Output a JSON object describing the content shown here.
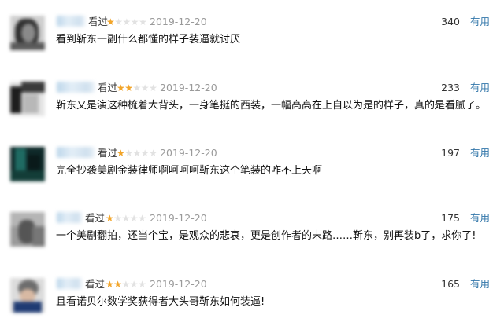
{
  "comments": [
    {
      "watched_label": "看过",
      "rating": 1,
      "max_rating": 5,
      "date": "2019-12-20",
      "votes": "340",
      "useful_label": "有用",
      "text": "看到靳东一副什么都懂的样子装逼就讨厌"
    },
    {
      "watched_label": "看过",
      "rating": 2,
      "max_rating": 5,
      "date": "2019-12-20",
      "votes": "233",
      "useful_label": "有用",
      "text": "靳东又是演这种梳着大背头，一身笔挺的西装，一幅高高在上自以为是的样子，真的是看腻了。"
    },
    {
      "watched_label": "看过",
      "rating": 1,
      "max_rating": 5,
      "date": "2019-12-20",
      "votes": "197",
      "useful_label": "有用",
      "text": "完全抄袭美剧金装律师啊呵呵呵靳东这个笔装的咋不上天啊"
    },
    {
      "watched_label": "看过",
      "rating": 1,
      "max_rating": 5,
      "date": "2019-12-20",
      "votes": "175",
      "useful_label": "有用",
      "text": "一个美剧翻拍，还当个宝，是观众的悲哀，更是创作者的末路……靳东，别再装b了，求你了!"
    },
    {
      "watched_label": "看过",
      "rating": 2,
      "max_rating": 5,
      "date": "2019-12-20",
      "votes": "165",
      "useful_label": "有用",
      "text": "且看诺贝尔数学奖获得者大头哥靳东如何装逼!"
    }
  ],
  "colors": {
    "star_on": "#f2a52a",
    "star_off": "#e2e2e2",
    "link": "#3377aa",
    "date": "#9a9a9a"
  }
}
